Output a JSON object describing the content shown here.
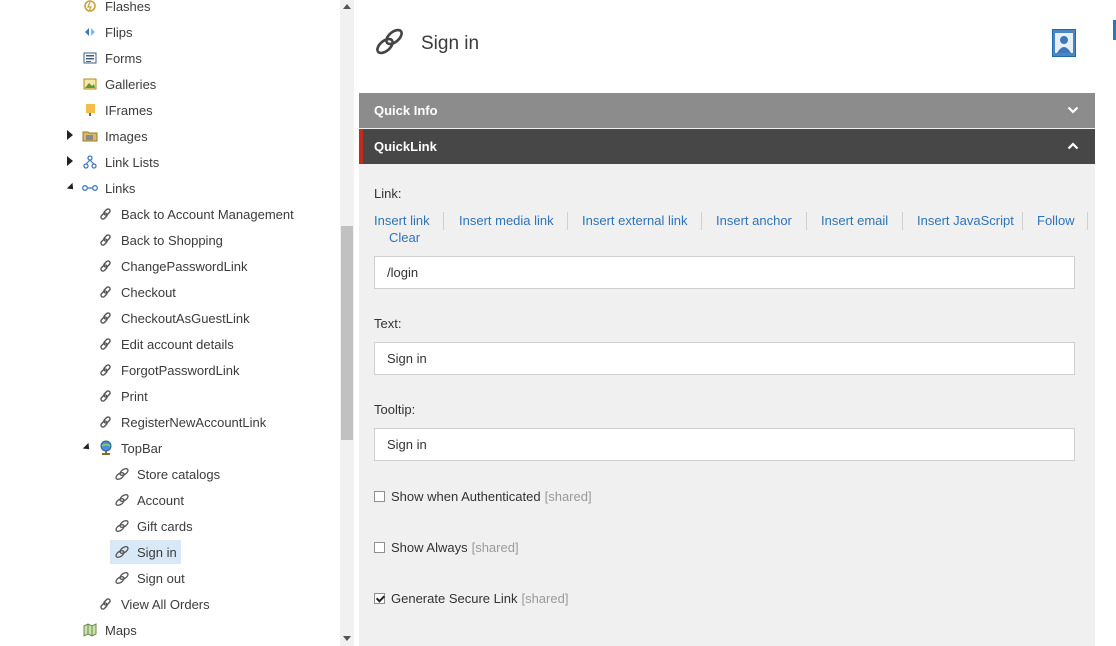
{
  "tree": {
    "items": [
      {
        "label": "Flashes",
        "icon": "flash-icon"
      },
      {
        "label": "Flips",
        "icon": "flip-icon"
      },
      {
        "label": "Forms",
        "icon": "form-icon"
      },
      {
        "label": "Galleries",
        "icon": "gallery-icon"
      },
      {
        "label": "IFrames",
        "icon": "iframe-icon"
      },
      {
        "label": "Images",
        "icon": "images-folder-icon"
      },
      {
        "label": "Link Lists",
        "icon": "link-list-icon"
      },
      {
        "label": "Links",
        "icon": "links-icon"
      },
      {
        "label": "Back to Account Management",
        "icon": "link-icon"
      },
      {
        "label": "Back to Shopping",
        "icon": "link-icon"
      },
      {
        "label": "ChangePasswordLink",
        "icon": "link-icon"
      },
      {
        "label": "Checkout",
        "icon": "link-icon"
      },
      {
        "label": "CheckoutAsGuestLink",
        "icon": "link-icon"
      },
      {
        "label": "Edit account details",
        "icon": "link-icon"
      },
      {
        "label": "ForgotPasswordLink",
        "icon": "link-icon"
      },
      {
        "label": "Print",
        "icon": "link-icon"
      },
      {
        "label": "RegisterNewAccountLink",
        "icon": "link-icon"
      },
      {
        "label": "TopBar",
        "icon": "globe-icon"
      },
      {
        "label": "Store catalogs",
        "icon": "quicklink-icon"
      },
      {
        "label": "Account",
        "icon": "quicklink-icon"
      },
      {
        "label": "Gift cards",
        "icon": "quicklink-icon"
      },
      {
        "label": "Sign in",
        "icon": "quicklink-icon"
      },
      {
        "label": "Sign out",
        "icon": "quicklink-icon"
      },
      {
        "label": "View All Orders",
        "icon": "link-icon"
      },
      {
        "label": "Maps",
        "icon": "map-icon"
      }
    ]
  },
  "editor": {
    "title": "Sign in",
    "sections": {
      "quick_info": "Quick Info",
      "quicklink": "QuickLink"
    },
    "link_label": "Link:",
    "link_actions": {
      "insert_link": "Insert link",
      "insert_media_link": "Insert media link",
      "insert_external_link": "Insert external link",
      "insert_anchor": "Insert anchor",
      "insert_email": "Insert email",
      "insert_javascript": "Insert JavaScript",
      "follow": "Follow",
      "clear": "Clear"
    },
    "link_value": "/login",
    "text_label": "Text:",
    "text_value": "Sign in",
    "tooltip_label": "Tooltip:",
    "tooltip_value": "Sign in",
    "checkboxes": [
      {
        "label": "Show when Authenticated",
        "tag": "[shared]",
        "checked": false
      },
      {
        "label": "Show Always",
        "tag": "[shared]",
        "checked": false
      },
      {
        "label": "Generate Secure Link",
        "tag": "[shared]",
        "checked": true
      }
    ]
  },
  "colors": {
    "accent": "#c22b1c",
    "link": "#2d74b8",
    "section_light": "#8c8c8c",
    "section_dark": "#474747",
    "selection": "#d9e8f6"
  }
}
